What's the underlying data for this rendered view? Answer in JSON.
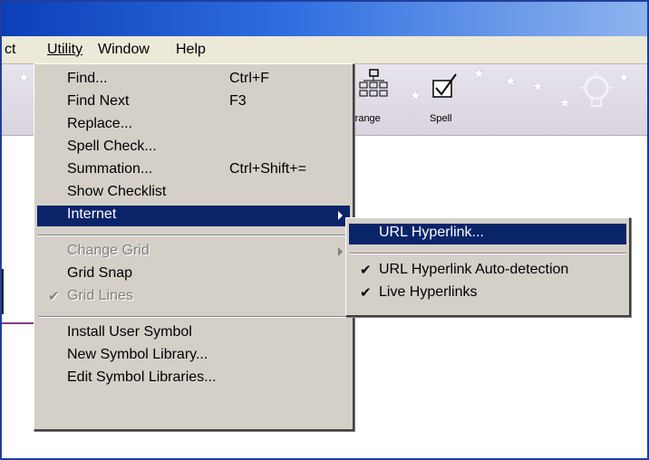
{
  "menubar": {
    "partial_item": "ct",
    "items": [
      {
        "label": "Utility"
      },
      {
        "label": "Window"
      },
      {
        "label": "Help"
      }
    ]
  },
  "toolbar": {
    "buttons": [
      {
        "label": "rrange",
        "icon": "arrange-icon"
      },
      {
        "label": "Spell",
        "icon": "spell-check-icon"
      }
    ]
  },
  "utility_menu": {
    "items": [
      {
        "label": "Find...",
        "shortcut": "Ctrl+F"
      },
      {
        "label": "Find Next",
        "shortcut": "F3"
      },
      {
        "label": "Replace..."
      },
      {
        "label": "Spell Check..."
      },
      {
        "label": "Summation...",
        "shortcut": "Ctrl+Shift+="
      },
      {
        "label": "Show Checklist"
      },
      {
        "label": "Internet",
        "submenu": true,
        "selected": true
      },
      {
        "label": "Change Grid",
        "submenu": true,
        "disabled": true
      },
      {
        "label": "Grid Snap"
      },
      {
        "label": "Grid Lines",
        "checked": true,
        "disabled": true
      },
      {
        "label": "Install User Symbol"
      },
      {
        "label": "New Symbol Library..."
      },
      {
        "label": "Edit Symbol Libraries..."
      }
    ]
  },
  "internet_submenu": {
    "items": [
      {
        "label": "URL Hyperlink...",
        "selected": true
      },
      {
        "label": "URL Hyperlink Auto-detection",
        "checked": true
      },
      {
        "label": "Live Hyperlinks",
        "checked": true
      }
    ]
  },
  "colors": {
    "menu_bg": "#d4d0c8",
    "highlight": "#0a246a",
    "titlebar": "#0c3fb8",
    "menubar_bg": "#ece9d8"
  }
}
